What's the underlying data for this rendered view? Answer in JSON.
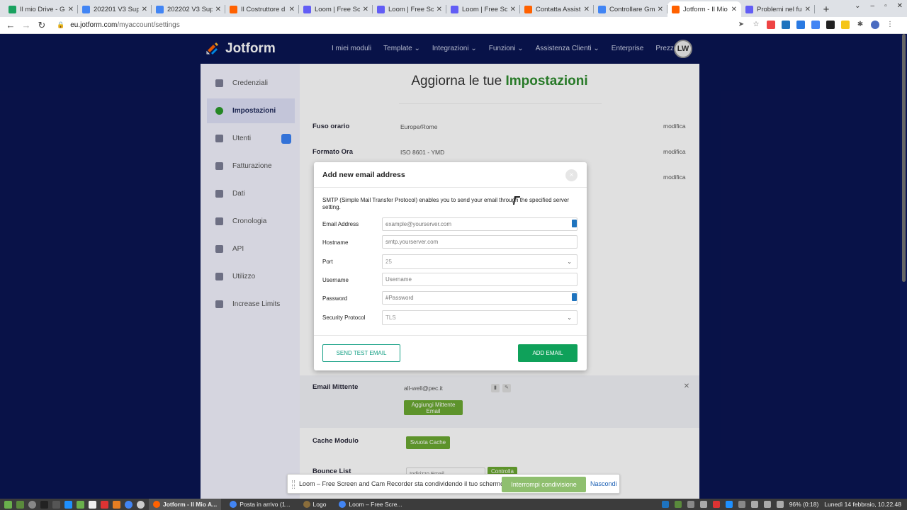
{
  "browser": {
    "tabs": [
      {
        "label": "Il mio Drive - Go",
        "color": "#1aa260"
      },
      {
        "label": "202201 V3 Supe",
        "color": "#4285f4"
      },
      {
        "label": "202202 V3 Supe",
        "color": "#4285f4"
      },
      {
        "label": "Il Costruttore d",
        "color": "#ff6100"
      },
      {
        "label": "Loom | Free Scr",
        "color": "#625df5"
      },
      {
        "label": "Loom | Free Scr",
        "color": "#625df5"
      },
      {
        "label": "Loom | Free Scr",
        "color": "#625df5"
      },
      {
        "label": "Contatta Assist",
        "color": "#ff6100"
      },
      {
        "label": "Controllare Gm",
        "color": "#4285f4"
      },
      {
        "label": "Jotform - Il Mio",
        "color": "#ff6100",
        "active": true
      },
      {
        "label": "Problemi nel fu",
        "color": "#625df5"
      }
    ],
    "tab_close": "✕",
    "new_tab": "+",
    "url_domain": "eu.jotform.com",
    "url_path": "/myaccount/settings"
  },
  "header": {
    "logo": "Jotform",
    "nav": [
      "I miei moduli",
      "Template ⌄",
      "Integrazioni ⌄",
      "Funzioni ⌄",
      "Assistenza Clienti ⌄",
      "Enterprise",
      "Prezzo"
    ],
    "avatar": "LW"
  },
  "sidebar": {
    "items": [
      {
        "label": "Credenziali",
        "icon": "user-icon"
      },
      {
        "label": "Impostazioni",
        "icon": "gear-icon",
        "active": true
      },
      {
        "label": "Utenti",
        "icon": "users-icon"
      },
      {
        "label": "Fatturazione",
        "icon": "invoice-icon"
      },
      {
        "label": "Dati",
        "icon": "database-icon"
      },
      {
        "label": "Cronologia",
        "icon": "history-icon"
      },
      {
        "label": "API",
        "icon": "api-icon"
      },
      {
        "label": "Utilizzo",
        "icon": "chart-icon"
      },
      {
        "label": "Increase Limits",
        "icon": "limits-icon"
      }
    ]
  },
  "main": {
    "title_prefix": "Aggiorna le tue",
    "title_highlight": "Impostazioni",
    "settings": [
      {
        "key": "Fuso orario",
        "value": "Europe/Rome",
        "action": "modifica"
      },
      {
        "key": "Formato Ora",
        "value": "ISO 8601 - YMD",
        "action": "modifica"
      },
      {
        "key": "",
        "value": "",
        "action": "modifica"
      }
    ],
    "email_sender": {
      "key": "Email Mittente",
      "value": "all-well@pec.it",
      "button": "Aggiungi Mittente Email"
    },
    "cache": {
      "key": "Cache Modulo",
      "button": "Svuota Cache"
    },
    "bounce": {
      "key": "Bounce List",
      "placeholder": "Indirizzo Email",
      "button": "Controlla"
    }
  },
  "modal": {
    "title": "Add new email address",
    "close": "×",
    "description": "SMTP (Simple Mail Transfer Protocol) enables you to send your email through the specified server setting.",
    "fields": [
      {
        "label": "Email Address",
        "placeholder": "example@yourserver.com"
      },
      {
        "label": "Hostname",
        "placeholder": "smtp.yourserver.com"
      },
      {
        "label": "Port",
        "value": "25"
      },
      {
        "label": "Username",
        "placeholder": "Username"
      },
      {
        "label": "Password",
        "placeholder": "#Password"
      },
      {
        "label": "Security Protocol",
        "value": "TLS"
      }
    ],
    "send_test": "SEND TEST EMAIL",
    "add": "ADD EMAIL"
  },
  "loom": {
    "message": "Loom – Free Screen and Cam Recorder sta condividendo il tuo schermo.",
    "stop": "Interrompi condivisione",
    "hide": "Nascondi"
  },
  "taskbar": {
    "tasks": [
      {
        "label": "Jotform - Il Mio A...",
        "color": "#ff6100",
        "active": true
      },
      {
        "label": "Posta in arrivo (1...",
        "color": "#4285f4"
      },
      {
        "label": "Logo",
        "color": "#8a6d3b"
      },
      {
        "label": "Loom – Free Scre...",
        "color": "#4285f4"
      }
    ],
    "battery": "96% (0:18)",
    "datetime": "Lunedì 14 febbraio, 10.22.48"
  }
}
